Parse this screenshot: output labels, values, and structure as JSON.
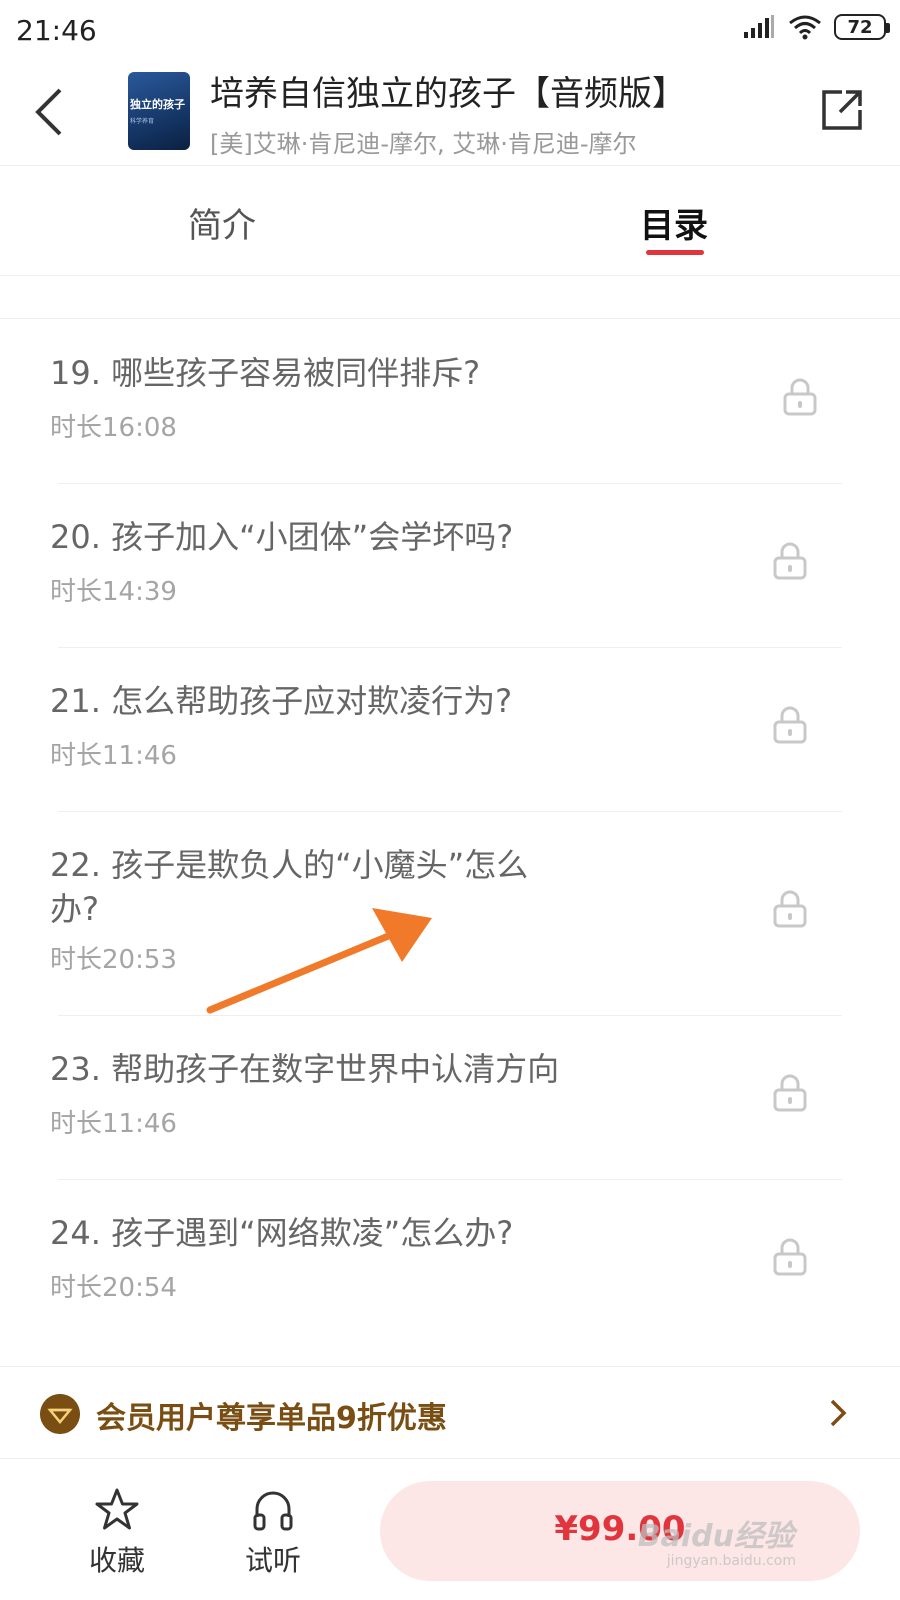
{
  "status_bar": {
    "time": "21:46",
    "battery": "72"
  },
  "header": {
    "cover_title": "独立的孩子",
    "cover_sub": "科学养育",
    "title": "培养自信独立的孩子【音频版】",
    "author": "[美]艾琳·肯尼迪-摩尔, 艾琳·肯尼迪-摩尔"
  },
  "tabs": [
    {
      "label": "简介",
      "active": false
    },
    {
      "label": "目录",
      "active": true
    }
  ],
  "chapters": [
    {
      "title": "19. 哪些孩子容易被同伴排斥?",
      "duration": "时长16:08",
      "locked": true
    },
    {
      "title": "20. 孩子加入“小团体”会学坏吗?",
      "duration": "时长14:39",
      "locked": true
    },
    {
      "title": "21. 怎么帮助孩子应对欺凌行为?",
      "duration": "时长11:46",
      "locked": true
    },
    {
      "title": "22. 孩子是欺负人的“小魔头”怎么办?",
      "duration": "时长20:53",
      "locked": true
    },
    {
      "title": "23. 帮助孩子在数字世界中认清方向",
      "duration": "时长11:46",
      "locked": true
    },
    {
      "title": "24. 孩子遇到“网络欺凌”怎么办?",
      "duration": "时长20:54",
      "locked": true
    }
  ],
  "member_bar": {
    "text": "会员用户尊享单品9折优惠"
  },
  "bottom_bar": {
    "favorite_label": "收藏",
    "listen_label": "试听",
    "price": "¥99.00"
  },
  "watermark": {
    "main": "Baidu经验",
    "sub": "jingyan.baidu.com"
  },
  "colors": {
    "accent": "#e0353d",
    "member": "#7a4e12",
    "annotation": "#f07a2a"
  }
}
